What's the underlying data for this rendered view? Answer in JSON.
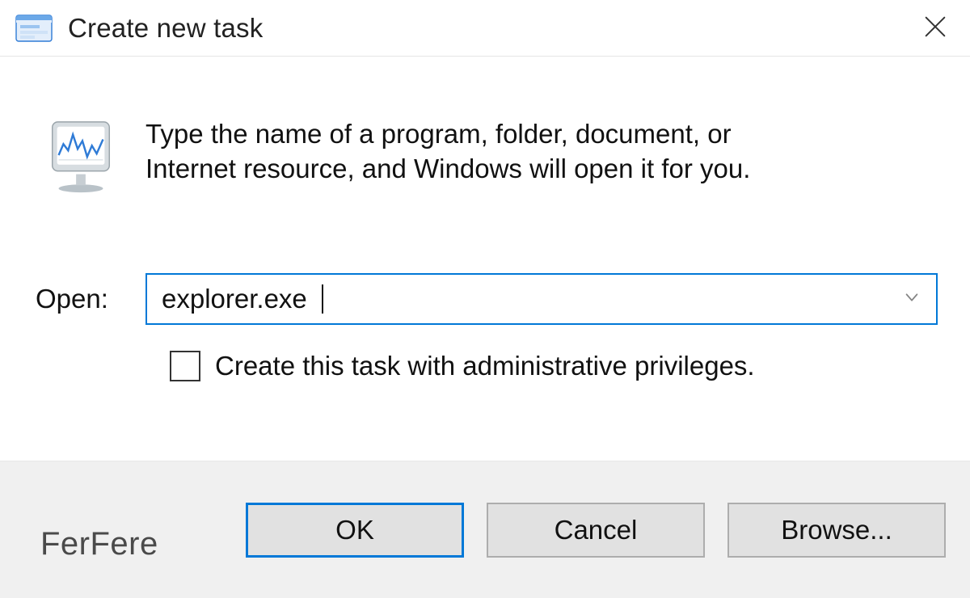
{
  "titlebar": {
    "title": "Create new task",
    "icon": "run-dialog-icon",
    "close": "close-icon"
  },
  "body": {
    "instruction": "Type the name of a program, folder, document, or Internet resource, and Windows will open it for you.",
    "open_label": "Open:",
    "open_value": "explorer.exe",
    "checkbox_label": "Create this task with administrative privileges.",
    "checkbox_checked": false
  },
  "footer": {
    "ok_label": "OK",
    "cancel_label": "Cancel",
    "browse_label": "Browse..."
  },
  "watermark": "FerFere",
  "colors": {
    "accent": "#0078d7",
    "footer_bg": "#f0f0f0",
    "button_bg": "#e1e1e1",
    "button_border": "#adadad"
  }
}
